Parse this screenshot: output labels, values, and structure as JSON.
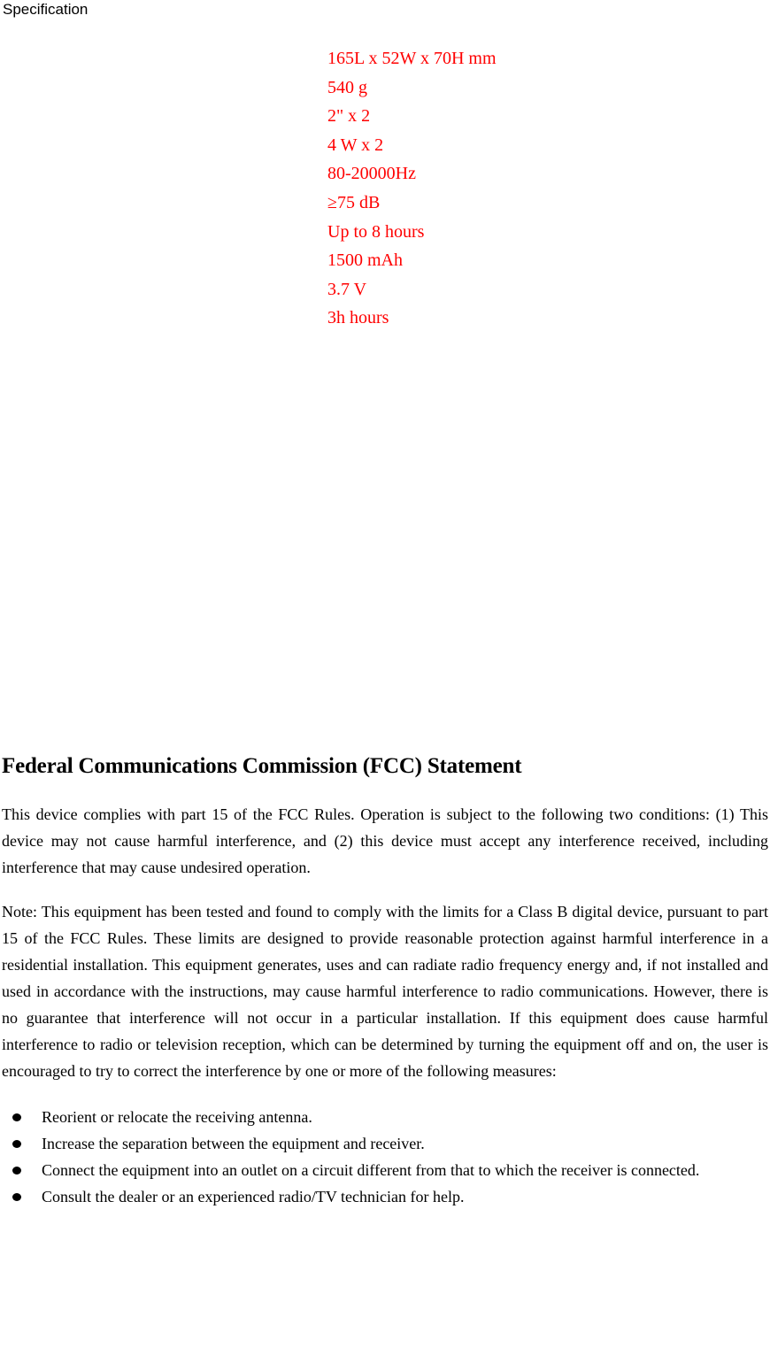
{
  "header": {
    "running_head": "Specification"
  },
  "specification": {
    "values": [
      "165L x 52W x 70H mm",
      "540 g",
      "2\" x 2",
      "4 W x 2",
      "80-20000Hz",
      "≥75 dB",
      "Up to 8 hours",
      "1500 mAh",
      "3.7 V",
      "3h hours"
    ],
    "text_color": "#FF0000"
  },
  "fcc": {
    "heading": "Federal Communications Commission (FCC) Statement",
    "paragraph_1": "This device complies with part 15 of the FCC Rules. Operation is subject to the following two conditions: (1) This device may not cause harmful interference, and (2) this device must accept any interference received, including interference that may cause undesired operation.",
    "paragraph_2": "Note: This equipment has been tested and found to comply with the limits for a Class B digital device, pursuant to part 15 of the FCC Rules. These limits are designed to provide reasonable protection against harmful interference in a residential installation. This equipment generates, uses and can radiate radio frequency energy and, if not installed and used in accordance with the instructions, may cause harmful interference to radio communications. However, there is no guarantee that interference will not occur in a particular installation. If this equipment does cause harmful interference to radio or television reception, which can be determined by turning the equipment off and on, the user is encouraged to try to correct the interference by one or more of the following measures:",
    "measures": [
      "Reorient or relocate the receiving antenna.",
      "Increase the separation between the equipment and receiver.",
      "Connect the equipment into an outlet on a circuit different from that to which the receiver is connected.",
      "Consult the dealer or an experienced radio/TV technician for help."
    ]
  }
}
